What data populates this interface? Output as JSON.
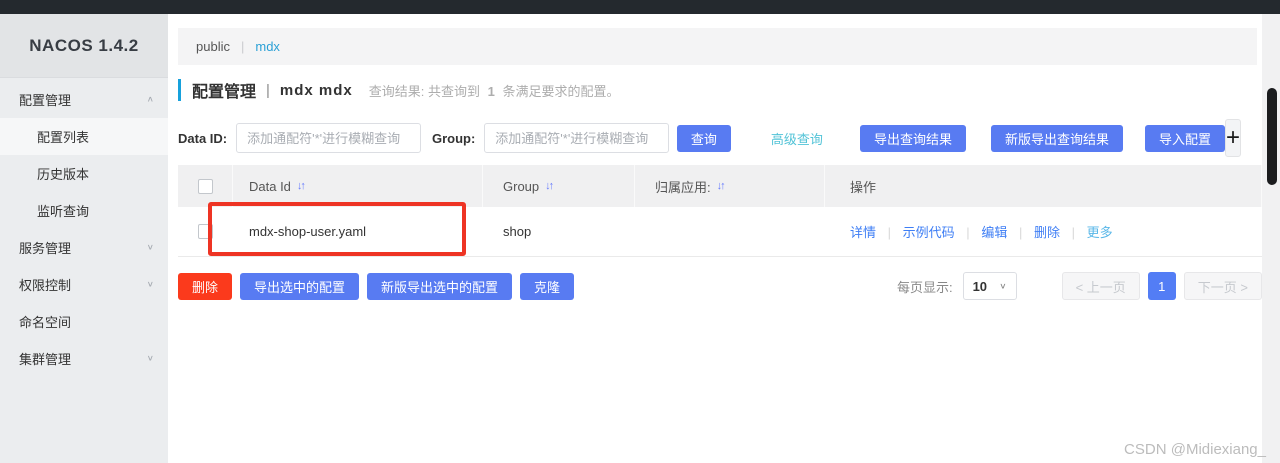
{
  "app": {
    "title": "NACOS 1.4.2"
  },
  "colors": {
    "accent_blue": "#587bf2",
    "accent_cyan": "#17a1dc",
    "link_blue": "#3e7ef5",
    "danger_red": "#fb3a1c",
    "annotation_red": "#ee3424"
  },
  "icons": {
    "sort": "↓↑",
    "chevron_down": "∨",
    "plus": "+"
  },
  "sidebar": {
    "items": [
      {
        "label": "配置管理",
        "chevron": "∧"
      },
      {
        "label": "配置列表",
        "chevron": ""
      },
      {
        "label": "历史版本",
        "chevron": ""
      },
      {
        "label": "监听查询",
        "chevron": ""
      },
      {
        "label": "服务管理",
        "chevron": "∨"
      },
      {
        "label": "权限控制",
        "chevron": "∨"
      },
      {
        "label": "命名空间",
        "chevron": ""
      },
      {
        "label": "集群管理",
        "chevron": "∨"
      }
    ]
  },
  "breadcrumb": {
    "namespace": "public",
    "separator": "|",
    "current": "mdx"
  },
  "page_header": {
    "title": "配置管理",
    "separator": "|",
    "subtitle": "mdx  mdx",
    "result_prefix": "查询结果: 共查询到",
    "result_count": "1",
    "result_suffix": "条满足要求的配置。"
  },
  "filters": {
    "data_id_label": "Data ID:",
    "data_id_placeholder": "添加通配符'*'进行模糊查询",
    "group_label": "Group:",
    "group_placeholder": "添加通配符'*'进行模糊查询",
    "search_button": "查询",
    "advanced_link": "高级查询",
    "export_button": "导出查询结果",
    "export_new_button": "新版导出查询结果",
    "import_button": "导入配置"
  },
  "table": {
    "headers": [
      "Data Id",
      "Group",
      "归属应用:",
      "操作"
    ],
    "action_separator": "|",
    "rows": [
      {
        "data_id": "mdx-shop-user.yaml",
        "group": "shop",
        "app": "",
        "actions": [
          "详情",
          "示例代码",
          "编辑",
          "删除",
          "更多"
        ]
      }
    ]
  },
  "footer": {
    "delete_button": "删除",
    "export_selected_button": "导出选中的配置",
    "export_selected_new_button": "新版导出选中的配置",
    "clone_button": "克隆",
    "page_size_label": "每页显示:",
    "page_size_value": "10",
    "prev_button": "< 上一页",
    "page_current": "1",
    "next_button": "下一页 >"
  },
  "watermark": "CSDN @Midiexiang_"
}
